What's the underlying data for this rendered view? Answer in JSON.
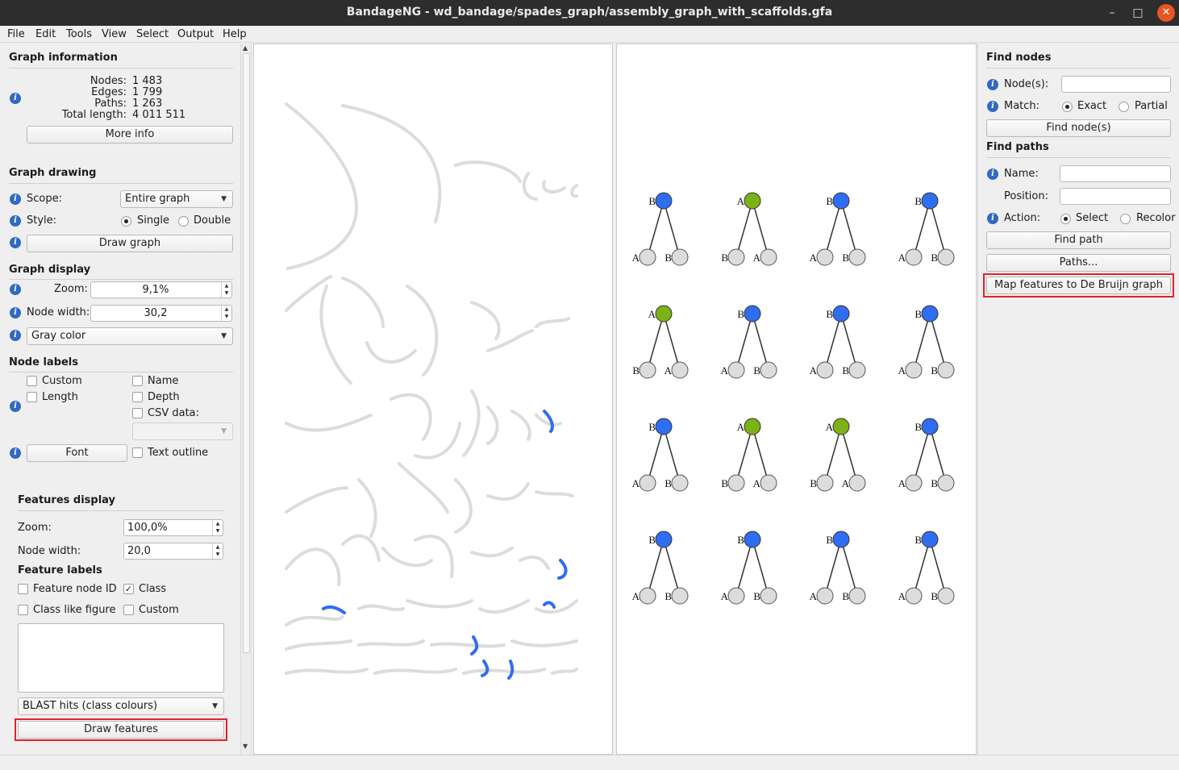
{
  "window": {
    "title": "BandageNG - wd_bandage/spades_graph/assembly_graph_with_scaffolds.gfa"
  },
  "menu": [
    "File",
    "Edit",
    "Tools",
    "View",
    "Select",
    "Output",
    "Help"
  ],
  "graph_info": {
    "title": "Graph information",
    "nodes_label": "Nodes:",
    "nodes": "1 483",
    "edges_label": "Edges:",
    "edges": "1 799",
    "paths_label": "Paths:",
    "paths": "1 263",
    "length_label": "Total length:",
    "length": "4 011 511",
    "more_info": "More info"
  },
  "graph_drawing": {
    "title": "Graph drawing",
    "scope_label": "Scope:",
    "scope": "Entire graph",
    "style_label": "Style:",
    "style_single": "Single",
    "style_double": "Double",
    "draw_graph": "Draw graph"
  },
  "graph_display": {
    "title": "Graph display",
    "zoom_label": "Zoom:",
    "zoom": "9,1%",
    "width_label": "Node width:",
    "width": "30,2",
    "color_scheme": "Gray color"
  },
  "node_labels": {
    "title": "Node labels",
    "custom": "Custom",
    "name": "Name",
    "length": "Length",
    "depth": "Depth",
    "csv": "CSV data:",
    "font": "Font",
    "outline": "Text outline"
  },
  "features_display": {
    "title": "Features display",
    "zoom_label": "Zoom:",
    "zoom": "100,0%",
    "width_label": "Node width:",
    "width": "20,0"
  },
  "feature_labels": {
    "title": "Feature labels",
    "node_id": "Feature node ID",
    "class": "Class",
    "class_fig": "Class like figure",
    "custom": "Custom",
    "source": "BLAST hits (class colours)",
    "draw": "Draw features"
  },
  "find_nodes": {
    "title": "Find nodes",
    "nodes_label": "Node(s):",
    "match_label": "Match:",
    "exact": "Exact",
    "partial": "Partial",
    "button": "Find node(s)"
  },
  "find_paths": {
    "title": "Find paths",
    "name_label": "Name:",
    "position_label": "Position:",
    "action_label": "Action:",
    "select": "Select",
    "recolor": "Recolor",
    "find_path": "Find path",
    "paths": "Paths...",
    "map": "Map features to De Bruijn graph"
  },
  "colors": {
    "blue": "#2f6df2",
    "green": "#7bb215",
    "gray": "#dcdcdc",
    "highlight": "#e5202e"
  },
  "trees": [
    {
      "root": "B",
      "rc": "blue",
      "l": "A",
      "r": "B"
    },
    {
      "root": "A",
      "rc": "green",
      "l": "B",
      "r": "A"
    },
    {
      "root": "B",
      "rc": "blue",
      "l": "A",
      "r": "B"
    },
    {
      "root": "B",
      "rc": "blue",
      "l": "A",
      "r": "B"
    },
    {
      "root": "A",
      "rc": "green",
      "l": "B",
      "r": "A"
    },
    {
      "root": "B",
      "rc": "blue",
      "l": "A",
      "r": "B"
    },
    {
      "root": "B",
      "rc": "blue",
      "l": "A",
      "r": "B"
    },
    {
      "root": "B",
      "rc": "blue",
      "l": "A",
      "r": "B"
    },
    {
      "root": "B",
      "rc": "blue",
      "l": "A",
      "r": "B"
    },
    {
      "root": "A",
      "rc": "green",
      "l": "B",
      "r": "A"
    },
    {
      "root": "A",
      "rc": "green",
      "l": "B",
      "r": "A"
    },
    {
      "root": "B",
      "rc": "blue",
      "l": "A",
      "r": "B"
    },
    {
      "root": "B",
      "rc": "blue",
      "l": "A",
      "r": "B"
    },
    {
      "root": "B",
      "rc": "blue",
      "l": "A",
      "r": "B"
    },
    {
      "root": "B",
      "rc": "blue",
      "l": "A",
      "r": "B"
    },
    {
      "root": "B",
      "rc": "blue",
      "l": "A",
      "r": "B"
    }
  ]
}
